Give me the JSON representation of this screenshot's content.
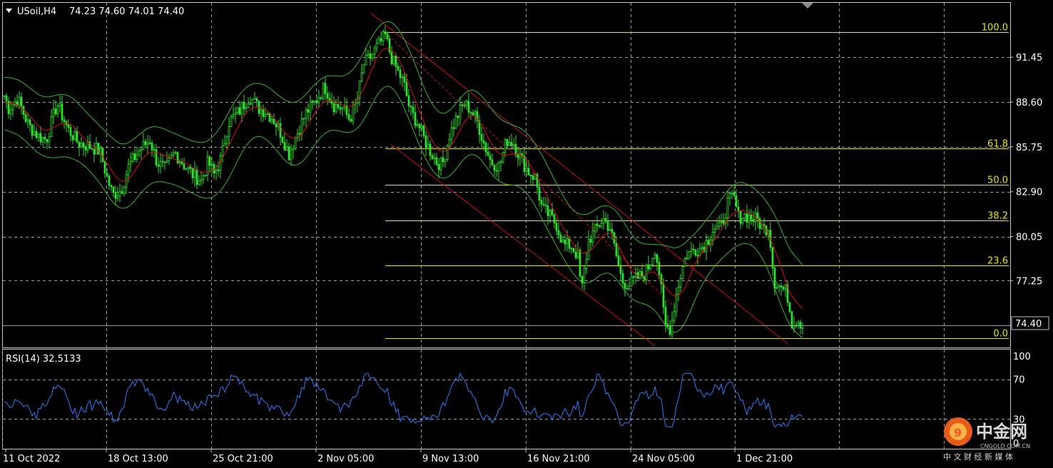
{
  "header": {
    "symbol": "USoil,H4",
    "ohlc": "74.23 74.60 74.01 74.40"
  },
  "indicator": {
    "label": "RSI(14) 32.5133"
  },
  "colors": {
    "background": "#000000",
    "grid": "#ffffff",
    "candle": "#33dd33",
    "bands": "#2fb82f",
    "ma": "#e01010",
    "channel": "#cc1010",
    "fib": "#e6e600",
    "rsi": "#2a7fff",
    "axis_text": "#ffffff"
  },
  "chart_data": [
    {
      "type": "candlestick",
      "title": "USoil,H4",
      "price_axis_ticks": [
        "91.45",
        "88.60",
        "85.75",
        "82.90",
        "80.05",
        "77.25"
      ],
      "current_price": "74.40",
      "x_tick_labels": [
        "11 Oct 2022",
        "18 Oct 13:00",
        "25 Oct 21:00",
        "2 Nov 05:00",
        "9 Nov 13:00",
        "16 Nov 21:00",
        "24 Nov 05:00",
        "1 Dec 21:00"
      ],
      "ylim": [
        73.0,
        94.9
      ],
      "grid": true,
      "overlays": [
        "Bollinger Bands",
        "Moving Average",
        "Descending Channel",
        "Fibonacci Retracement"
      ],
      "fibonacci": [
        {
          "level": "100.0",
          "price": 93.05
        },
        {
          "level": "61.8",
          "price": 85.65
        },
        {
          "level": "50.0",
          "price": 83.35
        },
        {
          "level": "38.2",
          "price": 81.05
        },
        {
          "level": "23.6",
          "price": 78.2
        },
        {
          "level": "0.0",
          "price": 73.6
        }
      ],
      "close_path": [
        [
          0,
          89.8
        ],
        [
          12,
          88.2
        ],
        [
          25,
          88.8
        ],
        [
          40,
          87.1
        ],
        [
          55,
          86.4
        ],
        [
          65,
          86.2
        ],
        [
          80,
          88.5
        ],
        [
          95,
          86.9
        ],
        [
          110,
          86.0
        ],
        [
          125,
          85.8
        ],
        [
          140,
          85.5
        ],
        [
          150,
          83.8
        ],
        [
          158,
          82.7
        ],
        [
          170,
          83.0
        ],
        [
          180,
          84.5
        ],
        [
          195,
          85.5
        ],
        [
          210,
          86.2
        ],
        [
          220,
          84.8
        ],
        [
          232,
          84.3
        ],
        [
          245,
          85.4
        ],
        [
          258,
          84.6
        ],
        [
          270,
          84.0
        ],
        [
          282,
          83.6
        ],
        [
          292,
          84.8
        ],
        [
          300,
          84.0
        ],
        [
          310,
          85.0
        ],
        [
          320,
          87.3
        ],
        [
          335,
          88.0
        ],
        [
          350,
          89.0
        ],
        [
          362,
          88.2
        ],
        [
          372,
          88.0
        ],
        [
          382,
          87.6
        ],
        [
          392,
          86.8
        ],
        [
          405,
          85.3
        ],
        [
          418,
          86.8
        ],
        [
          430,
          88.0
        ],
        [
          442,
          88.6
        ],
        [
          455,
          89.6
        ],
        [
          468,
          88.4
        ],
        [
          480,
          88.2
        ],
        [
          490,
          87.5
        ],
        [
          500,
          88.6
        ],
        [
          510,
          91.0
        ],
        [
          520,
          91.5
        ],
        [
          530,
          92.2
        ],
        [
          540,
          92.8
        ],
        [
          548,
          91.5
        ],
        [
          558,
          90.5
        ],
        [
          566,
          89.8
        ],
        [
          575,
          88.0
        ],
        [
          585,
          87.3
        ],
        [
          595,
          86.2
        ],
        [
          603,
          85.5
        ],
        [
          612,
          84.8
        ],
        [
          620,
          84.6
        ],
        [
          630,
          86.5
        ],
        [
          640,
          87.6
        ],
        [
          650,
          88.5
        ],
        [
          658,
          88.2
        ],
        [
          668,
          87.5
        ],
        [
          678,
          86.0
        ],
        [
          688,
          84.8
        ],
        [
          700,
          84.5
        ],
        [
          710,
          86.2
        ],
        [
          720,
          86.0
        ],
        [
          730,
          85.0
        ],
        [
          740,
          84.2
        ],
        [
          750,
          83.8
        ],
        [
          760,
          81.8
        ],
        [
          770,
          81.4
        ],
        [
          780,
          80.8
        ],
        [
          790,
          79.5
        ],
        [
          800,
          79.5
        ],
        [
          810,
          78.8
        ],
        [
          815,
          76.5
        ],
        [
          825,
          79.8
        ],
        [
          835,
          80.5
        ],
        [
          845,
          81.2
        ],
        [
          855,
          80.6
        ],
        [
          863,
          79.0
        ],
        [
          872,
          77.2
        ],
        [
          882,
          77.0
        ],
        [
          892,
          77.4
        ],
        [
          902,
          77.6
        ],
        [
          910,
          78.2
        ],
        [
          918,
          79.3
        ],
        [
          925,
          77.5
        ],
        [
          932,
          74.4
        ],
        [
          940,
          74.2
        ],
        [
          948,
          76.4
        ],
        [
          955,
          77.8
        ],
        [
          962,
          78.9
        ],
        [
          972,
          79.2
        ],
        [
          982,
          79.3
        ],
        [
          992,
          79.8
        ],
        [
          1000,
          80.6
        ],
        [
          1010,
          80.5
        ],
        [
          1020,
          82.2
        ],
        [
          1028,
          82.6
        ],
        [
          1035,
          81.3
        ],
        [
          1045,
          81.4
        ],
        [
          1055,
          81.2
        ],
        [
          1062,
          81.1
        ],
        [
          1070,
          80.5
        ],
        [
          1078,
          80.7
        ],
        [
          1085,
          77.2
        ],
        [
          1095,
          76.8
        ],
        [
          1103,
          76.5
        ],
        [
          1110,
          74.6
        ],
        [
          1118,
          74.8
        ],
        [
          1125,
          74.4
        ]
      ],
      "rsi": {
        "name": "RSI(14)",
        "last": 32.5133,
        "ticks": [
          "100",
          "70",
          "30",
          "0"
        ],
        "ylim": [
          0,
          100
        ]
      }
    }
  ],
  "watermark": {
    "brand": "中金网",
    "url": "CNGOLD.COM.CN",
    "tagline": "中 文 财 经 新 媒 体"
  }
}
